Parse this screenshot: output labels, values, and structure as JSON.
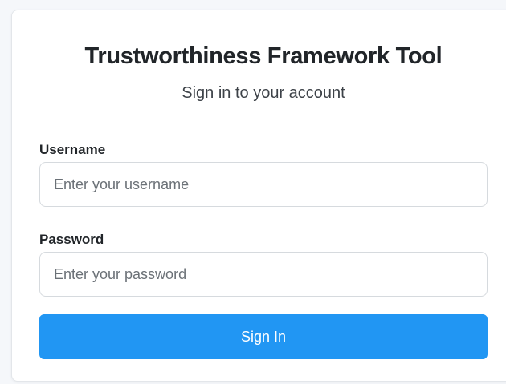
{
  "login": {
    "title": "Trustworthiness Framework Tool",
    "subtitle": "Sign in to your account",
    "username": {
      "label": "Username",
      "placeholder": "Enter your username",
      "value": ""
    },
    "password": {
      "label": "Password",
      "placeholder": "Enter your password",
      "value": ""
    },
    "submit_label": "Sign In"
  },
  "colors": {
    "accent": "#2196f3",
    "text": "#212529",
    "border": "#d6dade"
  }
}
